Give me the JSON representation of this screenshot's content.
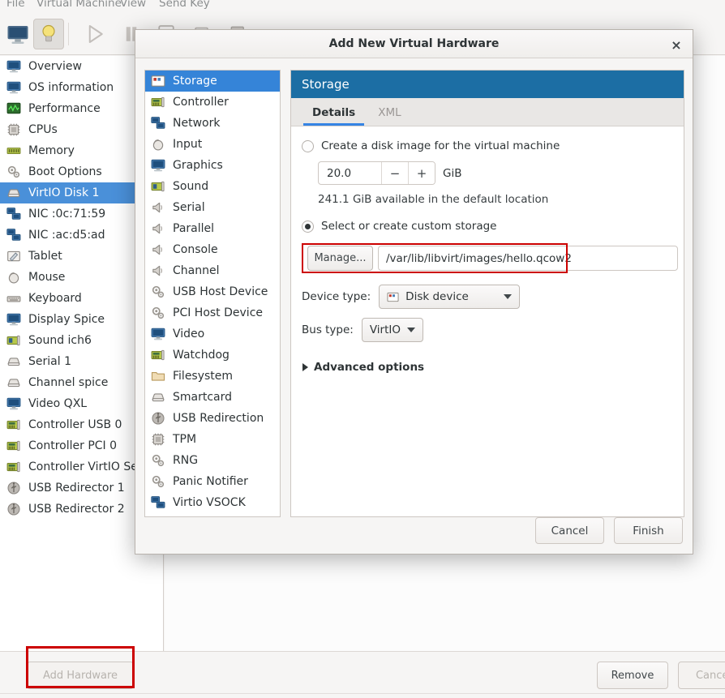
{
  "menubar": {
    "items": [
      "File",
      "Virtual Machine",
      "View",
      "Send Key"
    ]
  },
  "toolbar": {
    "buttons": [
      {
        "name": "show-console-button",
        "icon": "monitor-icon"
      },
      {
        "name": "show-details-button",
        "icon": "lightbulb-icon",
        "active": true
      },
      {
        "name": "run-button",
        "icon": "play-icon",
        "disabled": true
      },
      {
        "name": "pause-button",
        "icon": "pause-icon"
      },
      {
        "name": "shutdown-button",
        "icon": "power-icon"
      },
      {
        "name": "snapshots-button",
        "icon": "windows-icon"
      }
    ]
  },
  "sidebar": {
    "items": [
      {
        "label": "Overview",
        "icon": "monitor-icon"
      },
      {
        "label": "OS information",
        "icon": "monitor-icon"
      },
      {
        "label": "Performance",
        "icon": "graph-icon"
      },
      {
        "label": "CPUs",
        "icon": "cpu-icon"
      },
      {
        "label": "Memory",
        "icon": "memory-icon"
      },
      {
        "label": "Boot Options",
        "icon": "gears-icon"
      },
      {
        "label": "VirtIO Disk 1",
        "icon": "disk-icon",
        "selected": true
      },
      {
        "label": "NIC :0c:71:59",
        "icon": "network-icon"
      },
      {
        "label": "NIC :ac:d5:ad",
        "icon": "network-icon"
      },
      {
        "label": "Tablet",
        "icon": "tablet-icon"
      },
      {
        "label": "Mouse",
        "icon": "mouse-icon"
      },
      {
        "label": "Keyboard",
        "icon": "keyboard-icon"
      },
      {
        "label": "Display Spice",
        "icon": "monitor-icon"
      },
      {
        "label": "Sound ich6",
        "icon": "soundcard-icon"
      },
      {
        "label": "Serial 1",
        "icon": "disk-icon"
      },
      {
        "label": "Channel spice",
        "icon": "disk-icon"
      },
      {
        "label": "Video QXL",
        "icon": "monitor-icon"
      },
      {
        "label": "Controller USB 0",
        "icon": "card-icon"
      },
      {
        "label": "Controller PCI 0",
        "icon": "card-icon"
      },
      {
        "label": "Controller VirtIO Se",
        "icon": "card-icon"
      },
      {
        "label": "USB Redirector 1",
        "icon": "usb-icon"
      },
      {
        "label": "USB Redirector 2",
        "icon": "usb-icon"
      }
    ]
  },
  "bottom": {
    "add_hardware_label": "Add Hardware",
    "remove_label": "Remove",
    "cancel_label": "Cancel",
    "highlight_color": "#cc0000"
  },
  "dialog": {
    "title": "Add New Virtual Hardware",
    "close_glyph": "×",
    "device_list": [
      {
        "label": "Storage",
        "icon": "storage-icon",
        "selected": true
      },
      {
        "label": "Controller",
        "icon": "card-icon"
      },
      {
        "label": "Network",
        "icon": "network-icon"
      },
      {
        "label": "Input",
        "icon": "mouse-icon"
      },
      {
        "label": "Graphics",
        "icon": "monitor-icon"
      },
      {
        "label": "Sound",
        "icon": "soundcard-icon"
      },
      {
        "label": "Serial",
        "icon": "speaker-icon"
      },
      {
        "label": "Parallel",
        "icon": "speaker-icon"
      },
      {
        "label": "Console",
        "icon": "speaker-icon"
      },
      {
        "label": "Channel",
        "icon": "speaker-icon"
      },
      {
        "label": "USB Host Device",
        "icon": "gears-icon"
      },
      {
        "label": "PCI Host Device",
        "icon": "gears-icon"
      },
      {
        "label": "Video",
        "icon": "monitor-icon"
      },
      {
        "label": "Watchdog",
        "icon": "card-icon"
      },
      {
        "label": "Filesystem",
        "icon": "folder-icon"
      },
      {
        "label": "Smartcard",
        "icon": "disk-icon"
      },
      {
        "label": "USB Redirection",
        "icon": "usb-icon"
      },
      {
        "label": "TPM",
        "icon": "cpu-icon"
      },
      {
        "label": "RNG",
        "icon": "gears-icon"
      },
      {
        "label": "Panic Notifier",
        "icon": "gears-icon"
      },
      {
        "label": "Virtio VSOCK",
        "icon": "network-icon"
      }
    ],
    "pane_title": "Storage",
    "tabs": [
      {
        "label": "Details",
        "active": true
      },
      {
        "label": "XML",
        "active": false
      }
    ],
    "create_disk": {
      "radio_label": "Create a disk image for the virtual machine",
      "selected": false,
      "size_value": "20.0",
      "minus_glyph": "−",
      "plus_glyph": "+",
      "unit": "GiB",
      "hint": "241.1 GiB available in the default location"
    },
    "custom_storage": {
      "radio_label": "Select or create custom storage",
      "selected": true,
      "manage_label": "Manage...",
      "path_value": "/var/lib/libvirt/images/hello.qcow2",
      "highlight_color": "#cc0000"
    },
    "device_type": {
      "label": "Device type:",
      "value": "Disk device"
    },
    "bus_type": {
      "label": "Bus type:",
      "value": "VirtIO"
    },
    "advanced_options_label": "Advanced options",
    "actions": {
      "cancel_label": "Cancel",
      "finish_label": "Finish"
    }
  }
}
